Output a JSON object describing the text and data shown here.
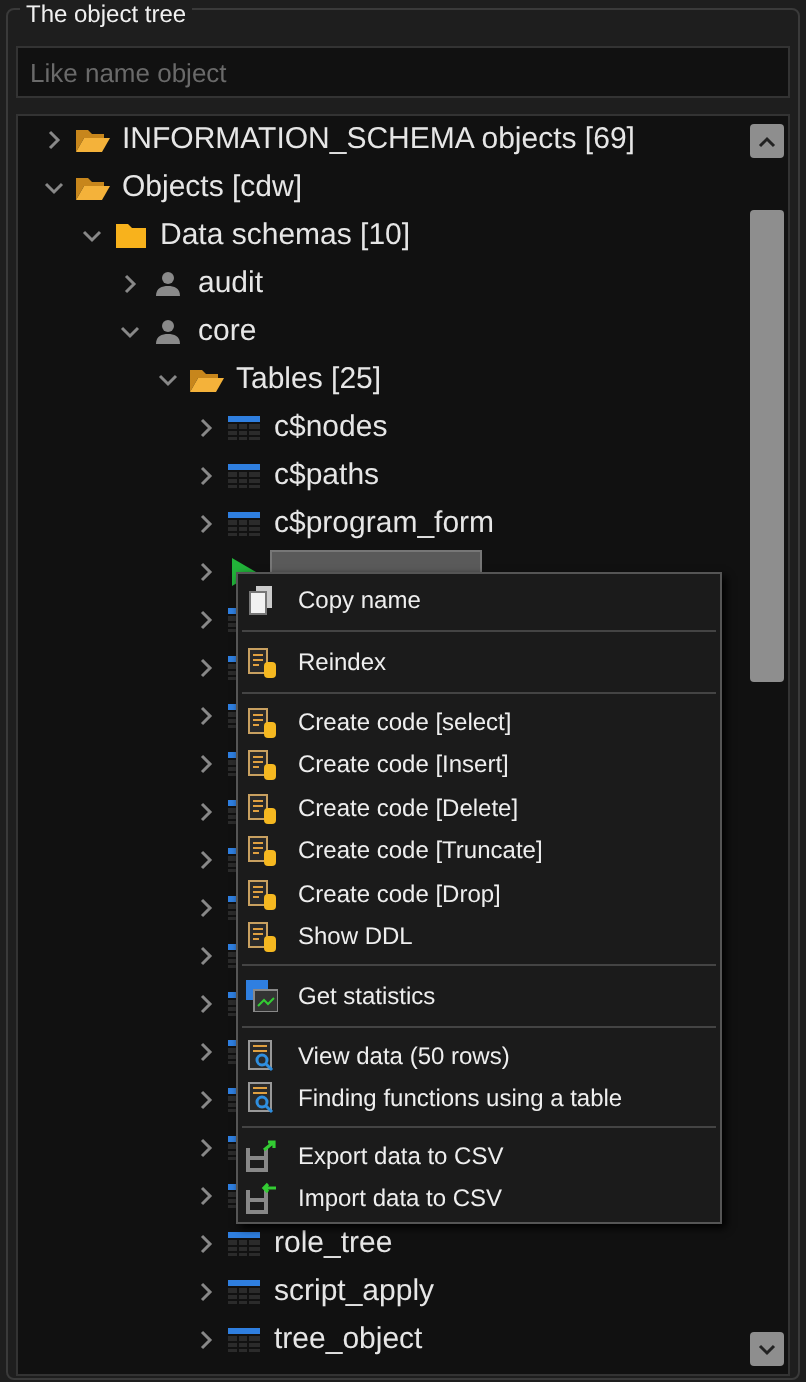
{
  "panel": {
    "title": "The object tree"
  },
  "search": {
    "placeholder": "Like name object"
  },
  "tree": [
    {
      "label": "INFORMATION_SCHEMA objects [69]",
      "kind": "folder-open",
      "expanded": false,
      "selected": false
    },
    {
      "label": "Objects [cdw]",
      "kind": "folder-open",
      "expanded": true,
      "selected": false,
      "children": [
        {
          "label": "Data schemas [10]",
          "kind": "folder",
          "expanded": true,
          "selected": false,
          "children": [
            {
              "label": "audit",
              "kind": "user",
              "expanded": false,
              "selected": false
            },
            {
              "label": "core",
              "kind": "user",
              "expanded": true,
              "selected": false,
              "children": [
                {
                  "label": "Tables [25]",
                  "kind": "folder-open",
                  "expanded": true,
                  "selected": false,
                  "children": [
                    {
                      "label": "c$nodes",
                      "kind": "table",
                      "expanded": false,
                      "selected": false
                    },
                    {
                      "label": "c$paths",
                      "kind": "table",
                      "expanded": false,
                      "selected": false
                    },
                    {
                      "label": "c$program_form",
                      "kind": "table",
                      "expanded": false,
                      "selected": false
                    },
                    {
                      "kind": "play",
                      "expanded": false,
                      "selected": true
                    },
                    {
                      "kind": "table",
                      "expanded": false,
                      "selected": false
                    },
                    {
                      "kind": "table",
                      "expanded": false,
                      "selected": false
                    },
                    {
                      "kind": "table",
                      "expanded": false,
                      "selected": false
                    },
                    {
                      "kind": "table",
                      "expanded": false,
                      "selected": false
                    },
                    {
                      "kind": "table",
                      "expanded": false,
                      "selected": false
                    },
                    {
                      "kind": "table",
                      "expanded": false,
                      "selected": false
                    },
                    {
                      "kind": "table",
                      "expanded": false,
                      "selected": false
                    },
                    {
                      "kind": "table",
                      "expanded": false,
                      "selected": false
                    },
                    {
                      "kind": "table",
                      "expanded": false,
                      "selected": false
                    },
                    {
                      "kind": "table",
                      "expanded": false,
                      "selected": false
                    },
                    {
                      "kind": "table",
                      "expanded": false,
                      "selected": false
                    },
                    {
                      "kind": "table",
                      "expanded": false,
                      "selected": false
                    },
                    {
                      "kind": "table",
                      "expanded": false,
                      "selected": false
                    },
                    {
                      "label": "role_tree",
                      "kind": "table",
                      "expanded": false,
                      "selected": false
                    },
                    {
                      "label": "script_apply",
                      "kind": "table",
                      "expanded": false,
                      "selected": false
                    },
                    {
                      "label": "tree_object",
                      "kind": "table",
                      "expanded": false,
                      "selected": false
                    }
                  ]
                }
              ]
            }
          ]
        }
      ]
    }
  ],
  "context_menu": [
    [
      {
        "label": "Copy name",
        "kind": "copy"
      }
    ],
    [
      {
        "label": "Reindex",
        "kind": "code"
      }
    ],
    [
      {
        "label": "Create code [select]",
        "kind": "code"
      },
      {
        "label": "Create code [Insert]",
        "kind": "code"
      },
      {
        "label": "Create code [Delete]",
        "kind": "code"
      },
      {
        "label": "Create code [Truncate]",
        "kind": "code"
      },
      {
        "label": "Create code [Drop]",
        "kind": "code"
      },
      {
        "label": "Show DDL",
        "kind": "code"
      }
    ],
    [
      {
        "label": "Get statistics",
        "kind": "stats"
      }
    ],
    [
      {
        "label": "View data (50 rows)",
        "kind": "view"
      },
      {
        "label": "Finding functions using a table",
        "kind": "view"
      }
    ],
    [
      {
        "label": "Export data to CSV",
        "kind": "export"
      },
      {
        "label": "Import data to CSV",
        "kind": "import"
      }
    ]
  ]
}
